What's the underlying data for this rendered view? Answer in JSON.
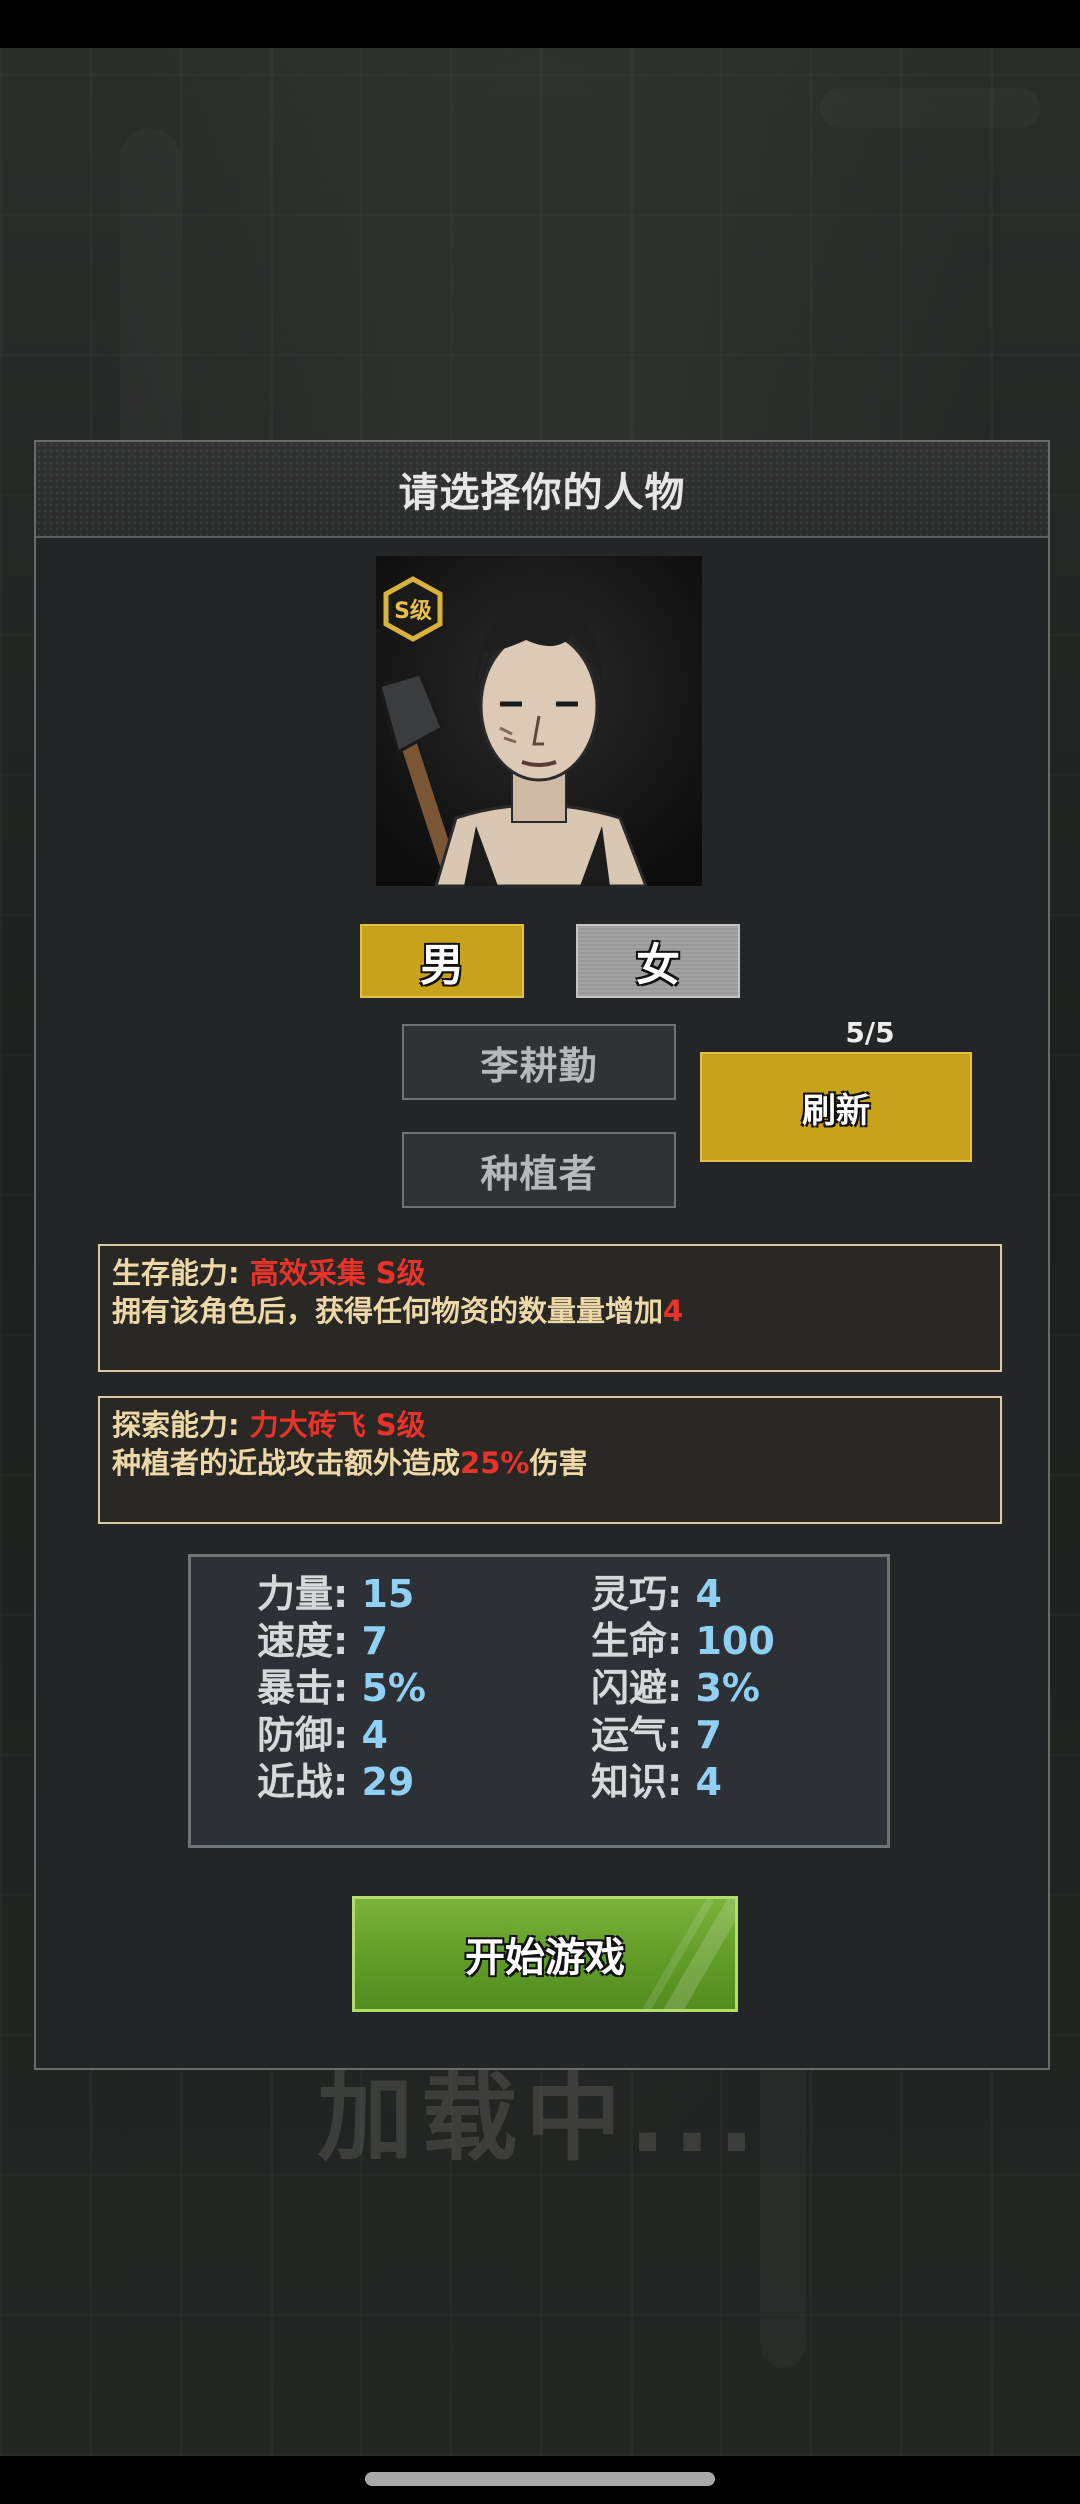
{
  "dialog": {
    "title": "请选择你的人物"
  },
  "portrait": {
    "grade_badge": "S级"
  },
  "gender": {
    "male": "男",
    "female": "女",
    "selected": "男"
  },
  "character": {
    "name": "李耕勤",
    "role": "种植者"
  },
  "refresh": {
    "count": "5/5",
    "label": "刷新"
  },
  "survival_ability": {
    "label": "生存能力: ",
    "name": "高效采集 S级",
    "desc": "拥有该角色后，获得任何物资的数量量增加",
    "value": "4"
  },
  "explore_ability": {
    "label": "探索能力: ",
    "name": "力大砖飞 S级",
    "desc_prefix": "种植者的近战攻击额外造成",
    "value": "25%",
    "desc_suffix": "伤害"
  },
  "stats": [
    {
      "label": "力量: ",
      "value": "15"
    },
    {
      "label": "灵巧: ",
      "value": "4"
    },
    {
      "label": "速度: ",
      "value": "7"
    },
    {
      "label": "生命: ",
      "value": "100"
    },
    {
      "label": "暴击: ",
      "value": "5%"
    },
    {
      "label": "闪避: ",
      "value": "3%"
    },
    {
      "label": "防御: ",
      "value": "4"
    },
    {
      "label": "运气: ",
      "value": "7"
    },
    {
      "label": "近战: ",
      "value": "29"
    },
    {
      "label": "知识: ",
      "value": "4"
    }
  ],
  "start_button": {
    "label": "开始游戏"
  },
  "background": {
    "loading_text": "加载中..."
  },
  "colors": {
    "accent_gold": "#c9a21b",
    "start_green": "#5f9a26",
    "highlight_red": "#e8332a",
    "stat_blue": "#8fd0f4"
  }
}
